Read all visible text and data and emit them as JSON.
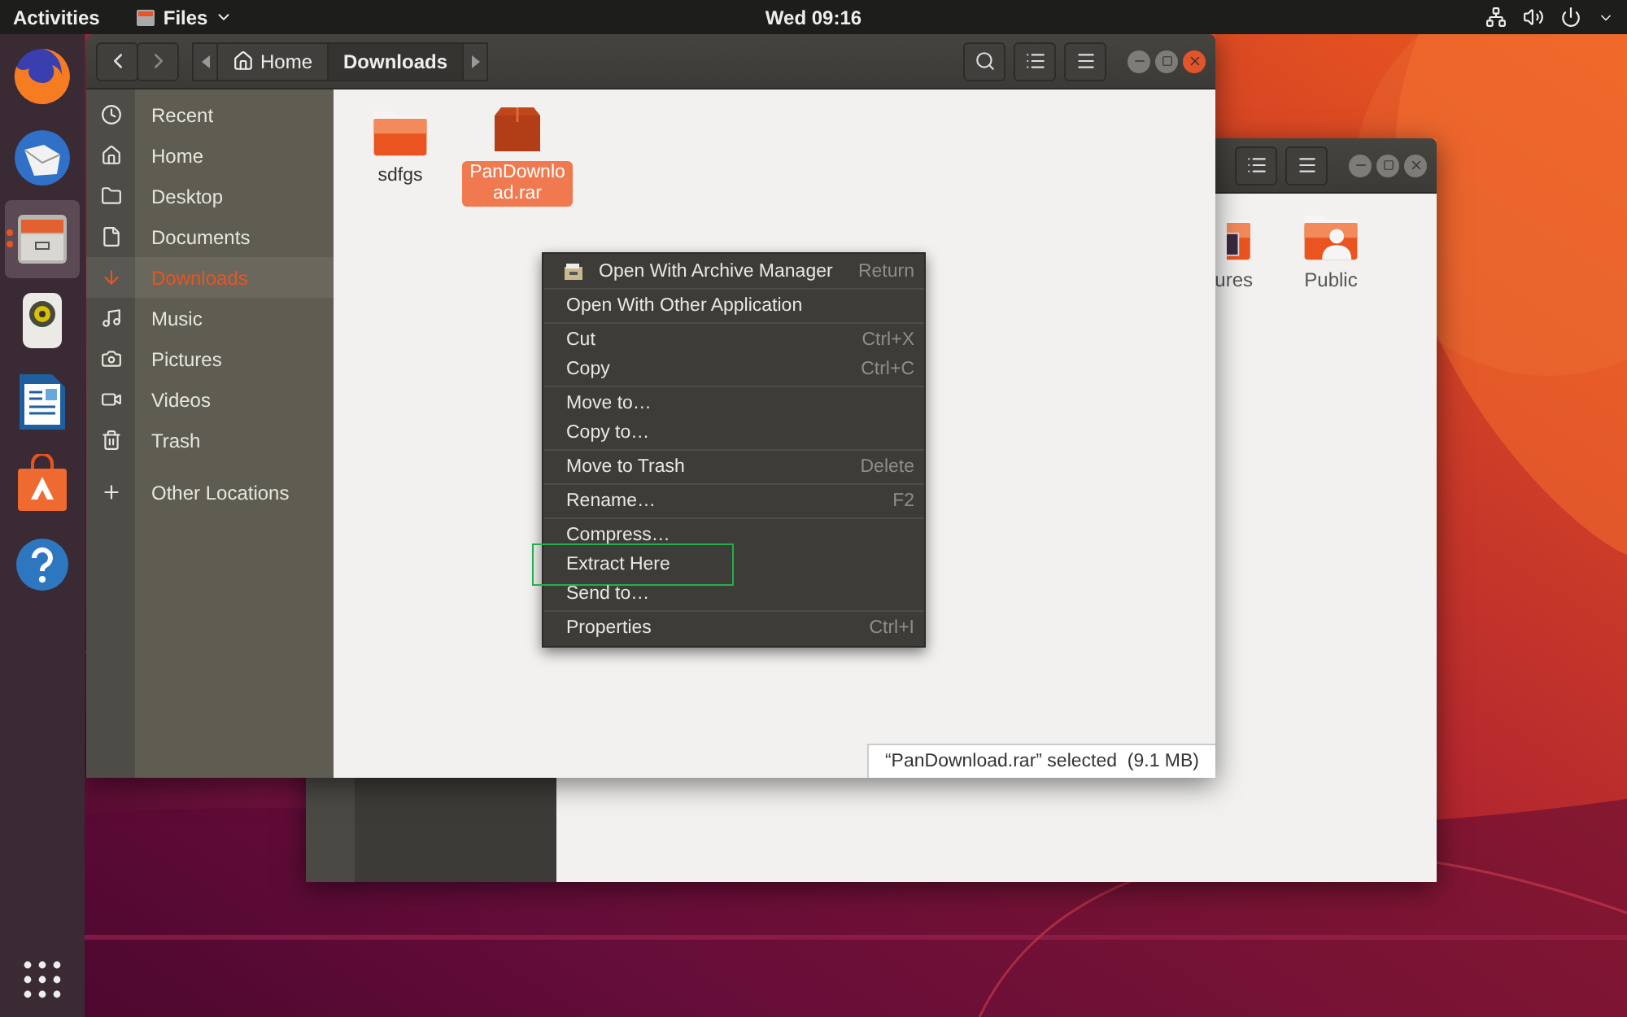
{
  "top_bar": {
    "activities": "Activities",
    "app_menu": "Files",
    "clock": "Wed 09:16"
  },
  "dock": [
    {
      "kind": "firefox",
      "selected": false,
      "running": false
    },
    {
      "kind": "mail",
      "selected": false,
      "running": false
    },
    {
      "kind": "files",
      "selected": true,
      "running": true
    },
    {
      "kind": "speaker",
      "selected": false,
      "running": false
    },
    {
      "kind": "writer",
      "selected": false,
      "running": false
    },
    {
      "kind": "store",
      "selected": false,
      "running": false
    },
    {
      "kind": "help",
      "selected": false,
      "running": false
    }
  ],
  "back_window": {
    "items": [
      {
        "label": "ures",
        "kind": "pictures"
      },
      {
        "label": "Public",
        "kind": "public"
      }
    ]
  },
  "window": {
    "crumbs": [
      {
        "label": "Home",
        "kind": "home",
        "selected": false
      },
      {
        "label": "Downloads",
        "kind": "folder",
        "selected": true
      }
    ],
    "sidebar": {
      "places": [
        {
          "label": "Recent",
          "kind": "recent",
          "selected": false
        },
        {
          "label": "Home",
          "kind": "home",
          "selected": false
        },
        {
          "label": "Desktop",
          "kind": "desktop",
          "selected": false
        },
        {
          "label": "Documents",
          "kind": "documents",
          "selected": false
        },
        {
          "label": "Downloads",
          "kind": "downloads",
          "selected": true
        },
        {
          "label": "Music",
          "kind": "music",
          "selected": false
        },
        {
          "label": "Pictures",
          "kind": "pictures",
          "selected": false
        },
        {
          "label": "Videos",
          "kind": "videos",
          "selected": false
        },
        {
          "label": "Trash",
          "kind": "trash",
          "selected": false
        }
      ],
      "other": {
        "label": "Other Locations"
      }
    },
    "files": [
      {
        "name": "sdfgs",
        "kind": "folder",
        "selected": false
      },
      {
        "name": "PanDownload.rar",
        "kind": "archive",
        "selected": true
      }
    ],
    "status": "“PanDownload.rar” selected  (9.1 MB)"
  },
  "context_menu": {
    "groups": [
      [
        {
          "label": "Open With Archive Manager",
          "shortcut": "Return",
          "icon": true,
          "annotated": false
        }
      ],
      [
        {
          "label": "Open With Other Application",
          "annotated": false
        }
      ],
      [
        {
          "label": "Cut",
          "shortcut": "Ctrl+X",
          "annotated": false
        },
        {
          "label": "Copy",
          "shortcut": "Ctrl+C",
          "annotated": false
        }
      ],
      [
        {
          "label": "Move to…",
          "annotated": false
        },
        {
          "label": "Copy to…",
          "annotated": false
        }
      ],
      [
        {
          "label": "Move to Trash",
          "shortcut": "Delete",
          "annotated": false
        }
      ],
      [
        {
          "label": "Rename…",
          "shortcut": "F2",
          "annotated": false
        }
      ],
      [
        {
          "label": "Compress…",
          "annotated": false
        },
        {
          "label": "Extract Here",
          "annotated": true
        },
        {
          "label": "Send to…",
          "annotated": false
        }
      ],
      [
        {
          "label": "Properties",
          "shortcut": "Ctrl+I",
          "annotated": false
        }
      ]
    ]
  }
}
